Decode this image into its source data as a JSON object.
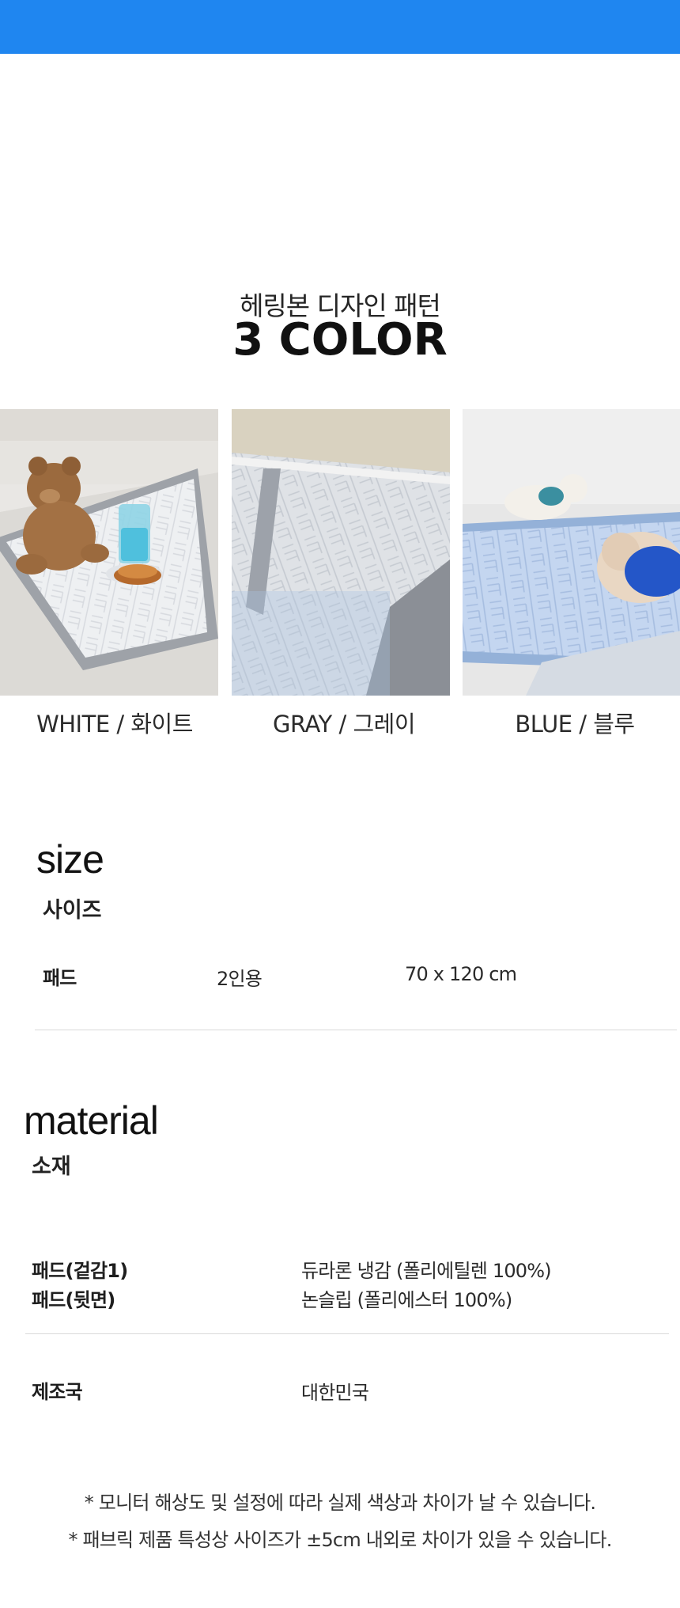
{
  "colors": {
    "topbar": "#1f86f0"
  },
  "hero": {
    "subtitle": "헤링본 디자인 패턴",
    "title": "3 COLOR"
  },
  "swatches": [
    {
      "caption": "WHITE / 화이트",
      "tone": "white"
    },
    {
      "caption": "GRAY / 그레이",
      "tone": "gray"
    },
    {
      "caption": "BLUE / 블루",
      "tone": "blue"
    }
  ],
  "size": {
    "heading_en": "size",
    "heading_ko": "사이즈",
    "row": {
      "item": "패드",
      "capacity": "2인용",
      "dimension": "70 x 120 cm"
    }
  },
  "material": {
    "heading_en": "material",
    "heading_ko": "소재",
    "rows": [
      {
        "label": "패드(겉감1)",
        "value": "듀라론 냉감 (폴리에틸렌 100%)"
      },
      {
        "label": "패드(뒷면)",
        "value": "논슬립 (폴리에스터 100%)"
      }
    ],
    "origin_label": "제조국",
    "origin_value": "대한민국"
  },
  "notes": [
    "* 모니터 해상도 및 설정에 따라 실제 색상과 차이가 날 수 있습니다.",
    "* 패브릭 제품 특성상 사이즈가 ±5cm 내외로 차이가 있을 수 있습니다."
  ]
}
